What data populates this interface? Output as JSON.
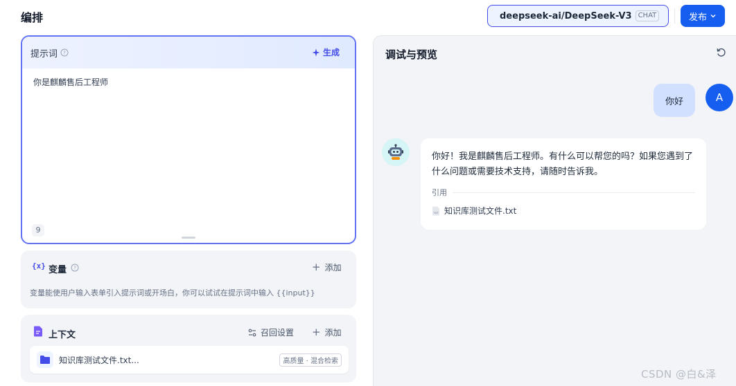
{
  "header": {
    "title": "编排",
    "model_name": "deepseek-ai/DeepSeek-V3",
    "model_badge": "CHAT",
    "publish_label": "发布"
  },
  "prompt": {
    "label": "提示词",
    "generate_label": "生成",
    "text": "你是麒麟售后工程师",
    "char_count": "9"
  },
  "variables": {
    "title": "变量",
    "add_label": "添加",
    "description": "变量能使用户输入表单引入提示词或开场白，你可以试试在提示词中输入 {{input}}"
  },
  "context": {
    "title": "上下文",
    "recall_label": "召回设置",
    "add_label": "添加",
    "file_name": "知识库测试文件.txt...",
    "file_tag": "高质量 · 混合检索"
  },
  "preview": {
    "title": "调试与预览",
    "user_message": "你好",
    "user_avatar": "A",
    "bot_message": "你好！我是麒麟售后工程师。有什么可以帮您的吗？如果您遇到了什么问题或需要技术支持，请随时告诉我。",
    "cite_label": "引用",
    "cite_file": "知识库测试文件.txt"
  },
  "watermark": "CSDN @白&泽",
  "colors": {
    "accent": "#155eef",
    "indigo": "#444ce7",
    "panel_bg": "#f2f4f7"
  }
}
